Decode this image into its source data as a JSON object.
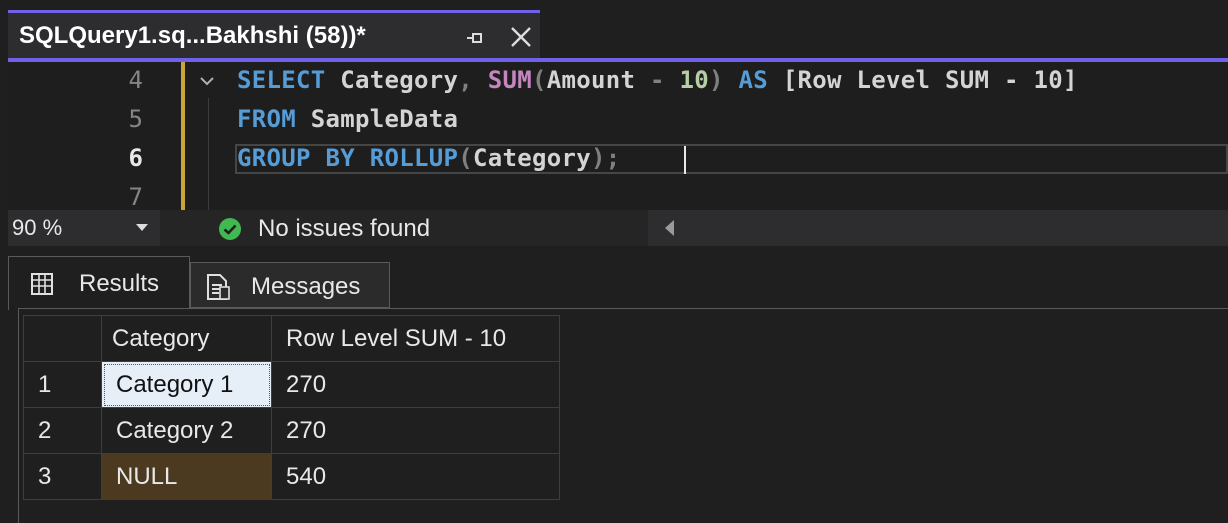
{
  "tab": {
    "title": "SQLQuery1.sq...Bakhshi (58))*",
    "pin_icon": "pin-icon",
    "close_icon": "close-icon"
  },
  "editor": {
    "lines": [
      {
        "number": "4",
        "text": "SELECT Category, SUM(Amount - 10) AS [Row Level SUM - 10]"
      },
      {
        "number": "5",
        "text": "FROM SampleData"
      },
      {
        "number": "6",
        "text": "GROUP BY ROLLUP(Category);"
      },
      {
        "number": "7",
        "text": ""
      }
    ],
    "tokens": {
      "line4": [
        "SELECT",
        " Category",
        ",",
        " SUM",
        "(",
        "Amount",
        " -",
        " 10",
        ")",
        " AS",
        " [Row Level SUM - 10]"
      ],
      "line5": [
        "FROM",
        " SampleData"
      ],
      "line6": [
        "GROUP BY ROLLUP",
        "(",
        "Category",
        ");"
      ]
    }
  },
  "status": {
    "zoom": "90 %",
    "issues": "No issues found",
    "issues_icon": "check-circle-icon"
  },
  "results": {
    "tabs": [
      {
        "label": "Results",
        "icon": "grid-icon",
        "active": true
      },
      {
        "label": "Messages",
        "icon": "messages-icon",
        "active": false
      }
    ],
    "columns": [
      "Category",
      "Row Level SUM - 10"
    ],
    "rows": [
      {
        "row": "1",
        "category": "Category 1",
        "value": "270"
      },
      {
        "row": "2",
        "category": "Category 2",
        "value": "270"
      },
      {
        "row": "3",
        "category": "NULL",
        "value": "540"
      }
    ]
  },
  "colors": {
    "accent": "#7160e8",
    "keyword": "#569cd6",
    "function": "#c586c0",
    "number": "#b5cea8",
    "null_highlight": "#4b3a1f",
    "selected_cell": "#e6eef7"
  }
}
